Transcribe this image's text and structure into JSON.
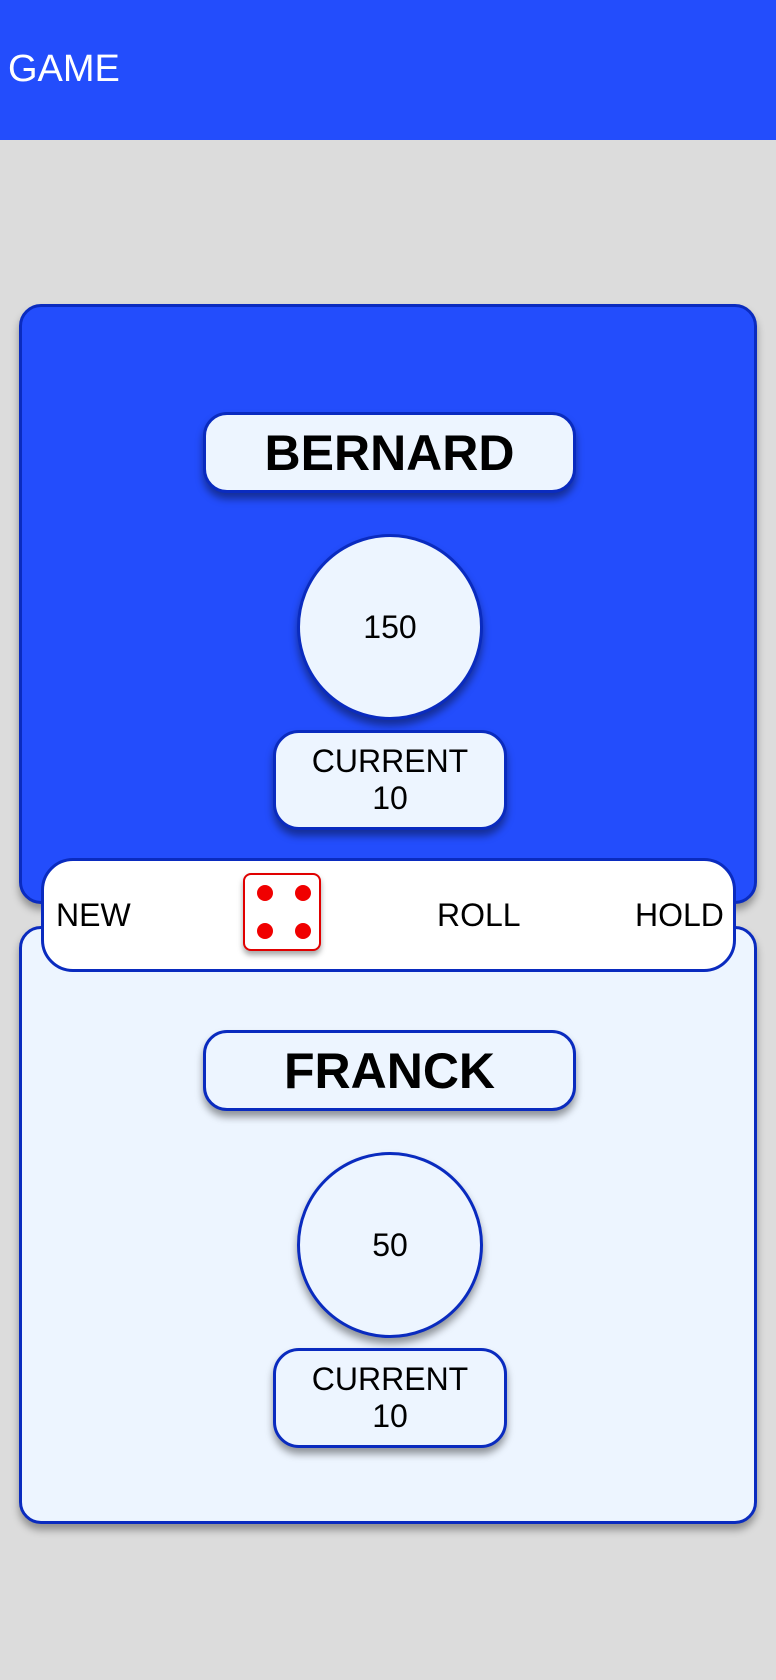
{
  "header": {
    "title": "GAME",
    "color": "#234dfc"
  },
  "players": [
    {
      "name": "BERNARD",
      "score": "150",
      "current_label": "CURRENT",
      "current_value": "10",
      "active": true,
      "panel_color": "#234dfc"
    },
    {
      "name": "FRANCK",
      "score": "50",
      "current_label": "CURRENT",
      "current_value": "10",
      "active": false,
      "panel_color": "#edf5ff"
    }
  ],
  "controls": {
    "new_label": "NEW",
    "roll_label": "ROLL",
    "hold_label": "HOLD",
    "dice_value": 4,
    "dice_pip_color": "#f00000"
  }
}
